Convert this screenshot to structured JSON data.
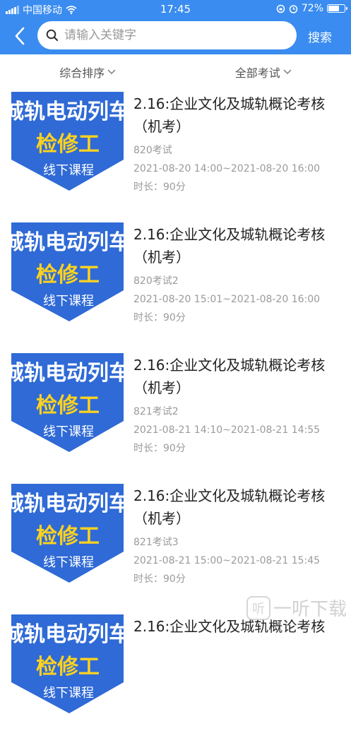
{
  "status_bar": {
    "carrier": "中国移动",
    "time": "17:45",
    "battery": "72%",
    "battery_level": 0.72
  },
  "nav": {
    "search_placeholder": "请输入关键字",
    "search_button": "搜索"
  },
  "filters": {
    "sort": "综合排序",
    "exam_type": "全部考试"
  },
  "thumbnail": {
    "line1": "城轨电动列车",
    "line2": "检修工",
    "line3": "线下课程"
  },
  "items": [
    {
      "title": "2.16:企业文化及城轨概论考核（机考）",
      "name": "820考试",
      "time": "2021-08-20 14:00~2021-08-20 16:00",
      "duration": "时长：90分"
    },
    {
      "title": "2.16:企业文化及城轨概论考核（机考）",
      "name": "820考试2",
      "time": "2021-08-20 15:01~2021-08-20 16:00",
      "duration": "时长：90分"
    },
    {
      "title": "2.16:企业文化及城轨概论考核（机考）",
      "name": "821考试2",
      "time": "2021-08-21 14:10~2021-08-21 14:55",
      "duration": "时长：90分"
    },
    {
      "title": "2.16:企业文化及城轨概论考核（机考）",
      "name": "821考试3",
      "time": "2021-08-21 15:00~2021-08-21 15:45",
      "duration": "时长：90分"
    },
    {
      "title": "2.16:企业文化及城轨概论考核",
      "name": "",
      "time": "",
      "duration": ""
    }
  ],
  "watermark": {
    "logo": "听",
    "text": "一听下载"
  },
  "colors": {
    "header": "#3a8cf0",
    "thumb_blue": "#2f6ad6",
    "thumb_yellow": "#ffd21f"
  }
}
